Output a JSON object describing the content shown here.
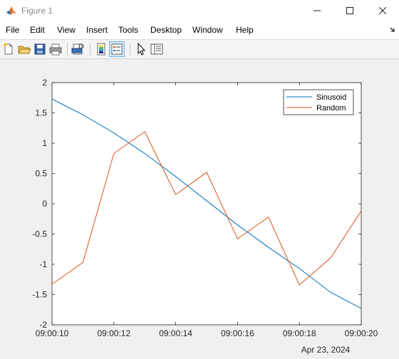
{
  "window": {
    "title": "Figure 1",
    "icon": "matlab-logo-icon"
  },
  "menu": {
    "items": [
      "File",
      "Edit",
      "View",
      "Insert",
      "Tools",
      "Desktop",
      "Window",
      "Help"
    ]
  },
  "toolbar": {
    "buttons": [
      "new-figure-icon",
      "open-file-icon",
      "save-icon",
      "print-icon",
      "print-preview-icon",
      "colorbar-icon",
      "legend-icon",
      "edit-plot-pointer-icon",
      "property-inspector-icon"
    ]
  },
  "colors": {
    "sinusoid": "#0072bd",
    "random": "#d95319"
  },
  "chart_data": {
    "type": "line",
    "x": [
      "09:00:10",
      "09:00:11",
      "09:00:12",
      "09:00:13",
      "09:00:14",
      "09:00:15",
      "09:00:16",
      "09:00:17",
      "09:00:18",
      "09:00:19",
      "09:00:20"
    ],
    "x_ticks": [
      "09:00:10",
      "09:00:12",
      "09:00:14",
      "09:00:16",
      "09:00:18",
      "09:00:20"
    ],
    "x_date_label": "Apr 23, 2024",
    "y_ticks": [
      "2",
      "1.5",
      "1",
      "0.5",
      "0",
      "-0.5",
      "-1",
      "-1.5",
      "-2"
    ],
    "ylim": [
      -2,
      2
    ],
    "xlabel": "",
    "ylabel": "",
    "title": "",
    "legend_position": "top-right",
    "grid": false,
    "series": [
      {
        "name": "Sinusoid",
        "values": [
          1.73,
          1.47,
          1.17,
          0.83,
          0.45,
          0.05,
          -0.35,
          -0.72,
          -1.07,
          -1.46,
          -1.73
        ]
      },
      {
        "name": "Random",
        "values": [
          -1.33,
          -0.97,
          0.83,
          1.19,
          0.15,
          0.52,
          -0.58,
          -0.22,
          -1.34,
          -0.9,
          -0.12
        ]
      }
    ]
  }
}
